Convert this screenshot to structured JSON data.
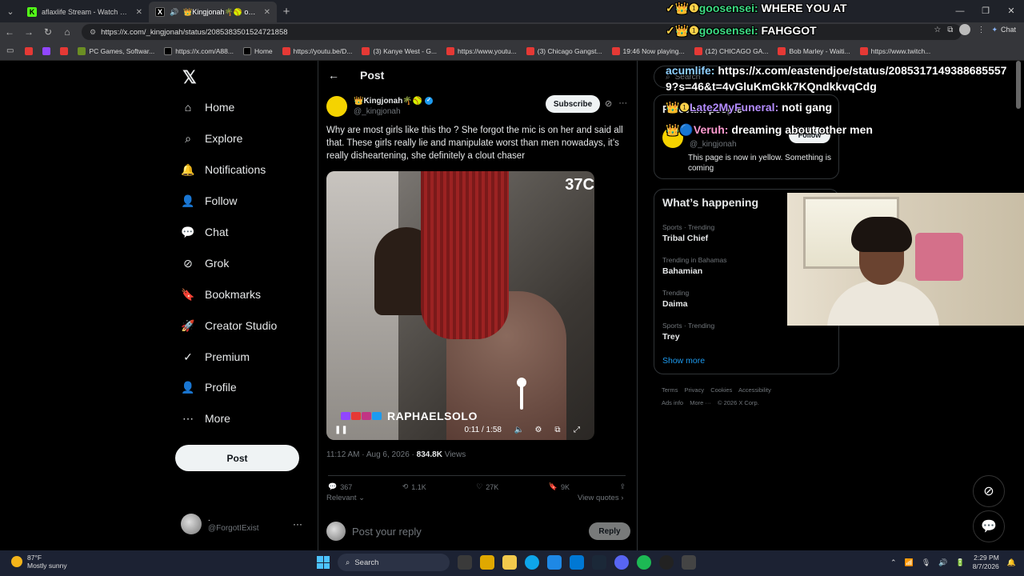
{
  "browser": {
    "tabs": [
      {
        "title": "aflaxlife Stream - Watch Live on Ki",
        "fav": "K",
        "favcolor": "#53fc18"
      },
      {
        "title": "👑Kingjonah🌴🥎 on X: \"W",
        "fav": "X",
        "favcolor": "#000000",
        "active": true
      }
    ],
    "url": "https://x.com/_kingjonah/status/2085383501524721858",
    "gemini_label": "Chat",
    "bookmarks": [
      "",
      "",
      "",
      "PC Games, Softwar...",
      "https://x.com/A88...",
      "Home",
      "https://youtu.be/D...",
      "(3) Kanye West - G...",
      "https://www.youtu...",
      "(3) Chicago Gangst...",
      "19:46 Now playing...",
      "(12) CHICAGO GA...",
      "Bob Marley - Waiti...",
      "https://www.twitch..."
    ]
  },
  "sidebar": {
    "logo": "𝕏",
    "items": [
      {
        "label": "Home",
        "icon": "home-icon",
        "glyph": "⌂"
      },
      {
        "label": "Explore",
        "icon": "search-icon",
        "glyph": "⌕"
      },
      {
        "label": "Notifications",
        "icon": "bell-icon",
        "glyph": "🔔"
      },
      {
        "label": "Follow",
        "icon": "follow-icon",
        "glyph": "👤"
      },
      {
        "label": "Chat",
        "icon": "chat-icon",
        "glyph": "💬"
      },
      {
        "label": "Grok",
        "icon": "grok-icon",
        "glyph": "⊘"
      },
      {
        "label": "Bookmarks",
        "icon": "bookmark-icon",
        "glyph": "🔖"
      },
      {
        "label": "Creator Studio",
        "icon": "rocket-icon",
        "glyph": "🚀"
      },
      {
        "label": "Premium",
        "icon": "verified-icon",
        "glyph": "✓"
      },
      {
        "label": "Profile",
        "icon": "profile-icon",
        "glyph": "👤"
      },
      {
        "label": "More",
        "icon": "more-icon",
        "glyph": "⋯"
      }
    ],
    "post_button": "Post",
    "account": {
      "name": ".",
      "handle": "@ForgotIExist"
    }
  },
  "post": {
    "header": "Post",
    "author_name": "👑Kingjonah🌴🥎",
    "author_handle": "@_kingjonah",
    "subscribe": "Subscribe",
    "text": "Why are most girls like this tho ? She forgot the mic is on her and said all that. These girls really lie and manipulate worst than  men nowadays, it’s really disheartening, she definitely a clout chaser",
    "video": {
      "counter": "37C",
      "watermark": "RAPHAELSOLO",
      "time": "0:11 / 1:58"
    },
    "timestamp": "11:12 AM · Aug 6, 2026 · ",
    "views": "834.8K",
    "views_label": " Views",
    "stats": {
      "replies": "367",
      "reposts": "1.1K",
      "likes": "27K",
      "bookmarks": "9K"
    },
    "relevant": "Relevant",
    "view_quotes": "View quotes",
    "reply_placeholder": "Post your reply",
    "reply_button": "Reply"
  },
  "right": {
    "search_placeholder": "Search",
    "relevant_title": "Relevant people",
    "rel_handle": "@_kingjonah",
    "rel_follow": "Follow",
    "rel_bio": "This page is now in yellow. Something is coming",
    "happening_title": "What’s happening",
    "trends": [
      {
        "context": "Sports · Trending",
        "name": "Tribal Chief"
      },
      {
        "context": "Trending in Bahamas",
        "name": "Bahamian"
      },
      {
        "context": "Trending",
        "name": "Daima"
      },
      {
        "context": "Sports · Trending",
        "name": "Trey"
      }
    ],
    "show_more": "Show more",
    "footer": [
      "Terms",
      "Privacy",
      "Cookies",
      "Accessibility",
      "Ads info",
      "More ···",
      "© 2026 X Corp."
    ]
  },
  "chat_overlay": [
    {
      "user": "goosensei:",
      "msg": "WHERE YOU AT"
    },
    {
      "user": "goosensei:",
      "msg": "FAHGGOT"
    },
    {
      "user": "acumlife:",
      "msg": "https://x.com/eastendjoe/status/20853171493886855579?s=46&t=4vGluKmGkk7KQndkkvqCdg"
    },
    {
      "user": "Late2MyFuneral:",
      "msg": "noti gang"
    },
    {
      "user": "Veruh:",
      "msg": "dreaming about other men"
    }
  ],
  "taskbar": {
    "weather_temp": "87°F",
    "weather_desc": "Mostly sunny",
    "search": "Search",
    "time": "2:29 PM",
    "date": "8/7/2026"
  }
}
